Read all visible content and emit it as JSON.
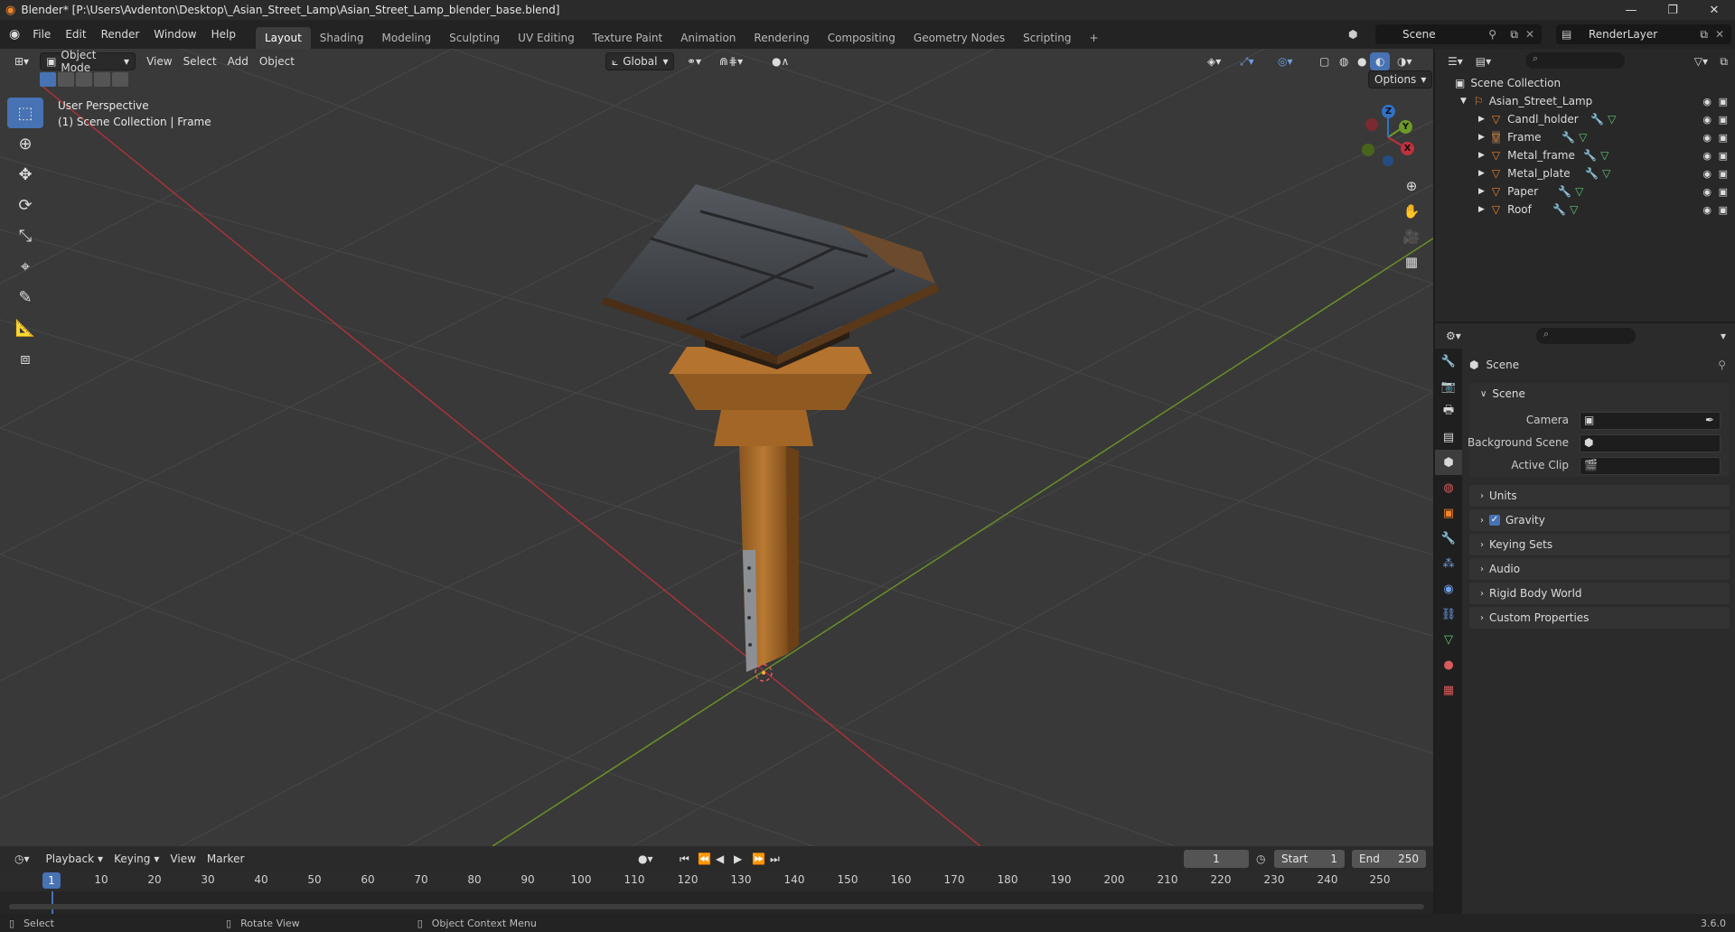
{
  "window": {
    "title": "Blender* [P:\\Users\\Avdenton\\Desktop\\_Asian_Street_Lamp\\Asian_Street_Lamp_blender_base.blend]",
    "minimize": "—",
    "maximize": "❐",
    "close": "✕"
  },
  "menu": {
    "items": [
      "File",
      "Edit",
      "Render",
      "Window",
      "Help"
    ],
    "workspaces": [
      "Layout",
      "Shading",
      "Modeling",
      "Sculpting",
      "UV Editing",
      "Texture Paint",
      "Animation",
      "Rendering",
      "Compositing",
      "Geometry Nodes",
      "Scripting"
    ],
    "add_workspace": "+",
    "scene": "Scene",
    "render_layer": "RenderLayer"
  },
  "viewport": {
    "mode": "Object Mode",
    "menus": [
      "View",
      "Select",
      "Add",
      "Object"
    ],
    "orientation": "Global",
    "options": "Options",
    "info_line1": "User Perspective",
    "info_line2": "(1) Scene Collection | Frame",
    "gizmo_labels": {
      "x": "X",
      "y": "Y",
      "z": "Z"
    }
  },
  "outliner": {
    "root": "Scene Collection",
    "collection": "Asian_Street_Lamp",
    "objects": [
      "Candl_holder",
      "Frame",
      "Metal_frame",
      "Metal_plate",
      "Paper",
      "Roof"
    ]
  },
  "properties": {
    "header": "Scene",
    "panel_scene": "Scene",
    "fields": [
      "Camera",
      "Background Scene",
      "Active Clip"
    ],
    "panels": [
      "Units",
      "Gravity",
      "Keying Sets",
      "Audio",
      "Rigid Body World",
      "Custom Properties"
    ],
    "gravity_checked": true
  },
  "timeline": {
    "menus": [
      "Playback",
      "Keying",
      "View",
      "Marker"
    ],
    "current_frame": "1",
    "start_label": "Start",
    "start": "1",
    "end_label": "End",
    "end": "250",
    "ticks": [
      "1",
      "10",
      "20",
      "30",
      "40",
      "50",
      "60",
      "70",
      "80",
      "90",
      "100",
      "110",
      "120",
      "130",
      "140",
      "150",
      "160",
      "170",
      "180",
      "190",
      "200",
      "210",
      "220",
      "230",
      "240",
      "250"
    ]
  },
  "status": {
    "select": "Select",
    "rotate": "Rotate View",
    "context": "Object Context Menu",
    "version": "3.6.0"
  },
  "colors": {
    "accent": "#4772b3",
    "x_axis": "#c0313f",
    "y_axis": "#6f9a27",
    "z_axis": "#2f72c8",
    "wood": "#a86b2a",
    "roof": "#3a3d42"
  }
}
